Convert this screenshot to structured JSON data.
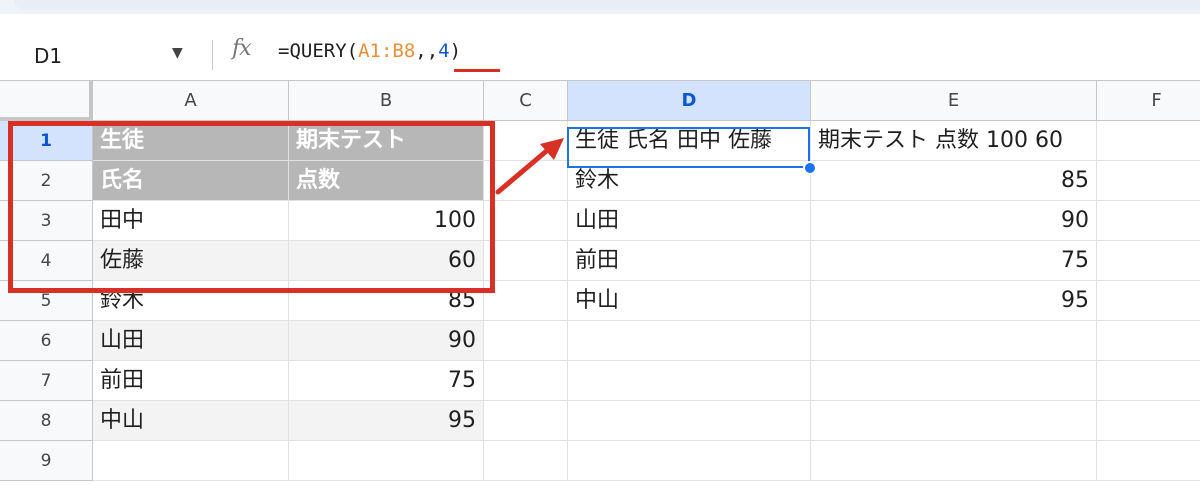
{
  "formula_bar": {
    "cell_ref": "D1",
    "formula_prefix": "=QUERY(",
    "formula_range": "A1:B8",
    "formula_sep": ",,",
    "formula_arg": "4",
    "formula_suffix": ")"
  },
  "columns": [
    "A",
    "B",
    "C",
    "D",
    "E",
    "F"
  ],
  "rows": [
    "1",
    "2",
    "3",
    "4",
    "5",
    "6",
    "7",
    "8",
    "9"
  ],
  "cells": {
    "A": [
      "生徒",
      "氏名",
      "田中",
      "佐藤",
      "鈴木",
      "山田",
      "前田",
      "中山",
      ""
    ],
    "B": [
      "期末テスト",
      "点数",
      "100",
      "60",
      "85",
      "90",
      "75",
      "95",
      ""
    ],
    "D": [
      "生徒 氏名 田中 佐藤",
      "鈴木",
      "山田",
      "前田",
      "中山",
      "",
      "",
      "",
      ""
    ],
    "E": [
      "期末テスト 点数 100 60",
      "85",
      "90",
      "75",
      "95",
      "",
      "",
      "",
      ""
    ]
  },
  "colors": {
    "highlight_box": "#d93025",
    "selection": "#1a73e8",
    "header_fill": "#b7b7b7"
  }
}
